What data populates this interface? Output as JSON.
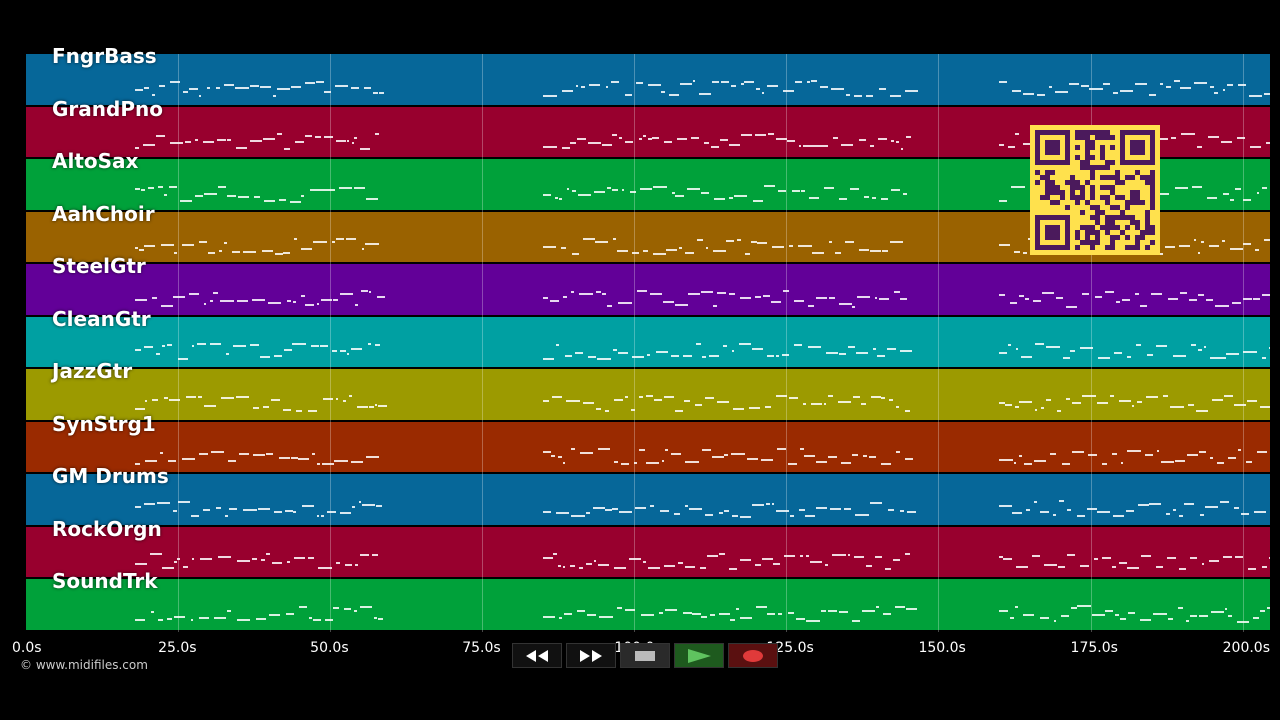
{
  "tracks": [
    {
      "name": "FngrBass",
      "color": "#066799"
    },
    {
      "name": "GrandPno",
      "color": "#98002e"
    },
    {
      "name": "AltoSax",
      "color": "#00a13a"
    },
    {
      "name": "AahChoir",
      "color": "#9a6200"
    },
    {
      "name": "SteelGtr",
      "color": "#620098"
    },
    {
      "name": "CleanGtr",
      "color": "#00a0a2"
    },
    {
      "name": "JazzGtr",
      "color": "#9c9a00"
    },
    {
      "name": "SynStrg1",
      "color": "#9a2a00"
    },
    {
      "name": "GM Drums",
      "color": "#066799"
    },
    {
      "name": "RockOrgn",
      "color": "#98002e"
    },
    {
      "name": "SoundTrk",
      "color": "#00a13a"
    }
  ],
  "timeline": {
    "ticks": [
      "0.0s",
      "25.0s",
      "50.0s",
      "75.0s",
      "100.0s",
      "125.0s",
      "150.0s",
      "175.0s",
      "200.0s"
    ],
    "max_seconds": 204.5
  },
  "transport": {
    "rewind_icon": "rewind-icon",
    "forward_icon": "fast-forward-icon",
    "stop_icon": "stop-icon",
    "play_icon": "play-icon",
    "record_icon": "record-icon",
    "play_color": "#3a9a3a",
    "record_color": "#d33"
  },
  "footer": {
    "copyright": "© www.midifiles.com"
  },
  "qr": {
    "icon": "qr-code-icon",
    "color": "#ffe14d",
    "dark": "#4b1a5c"
  }
}
